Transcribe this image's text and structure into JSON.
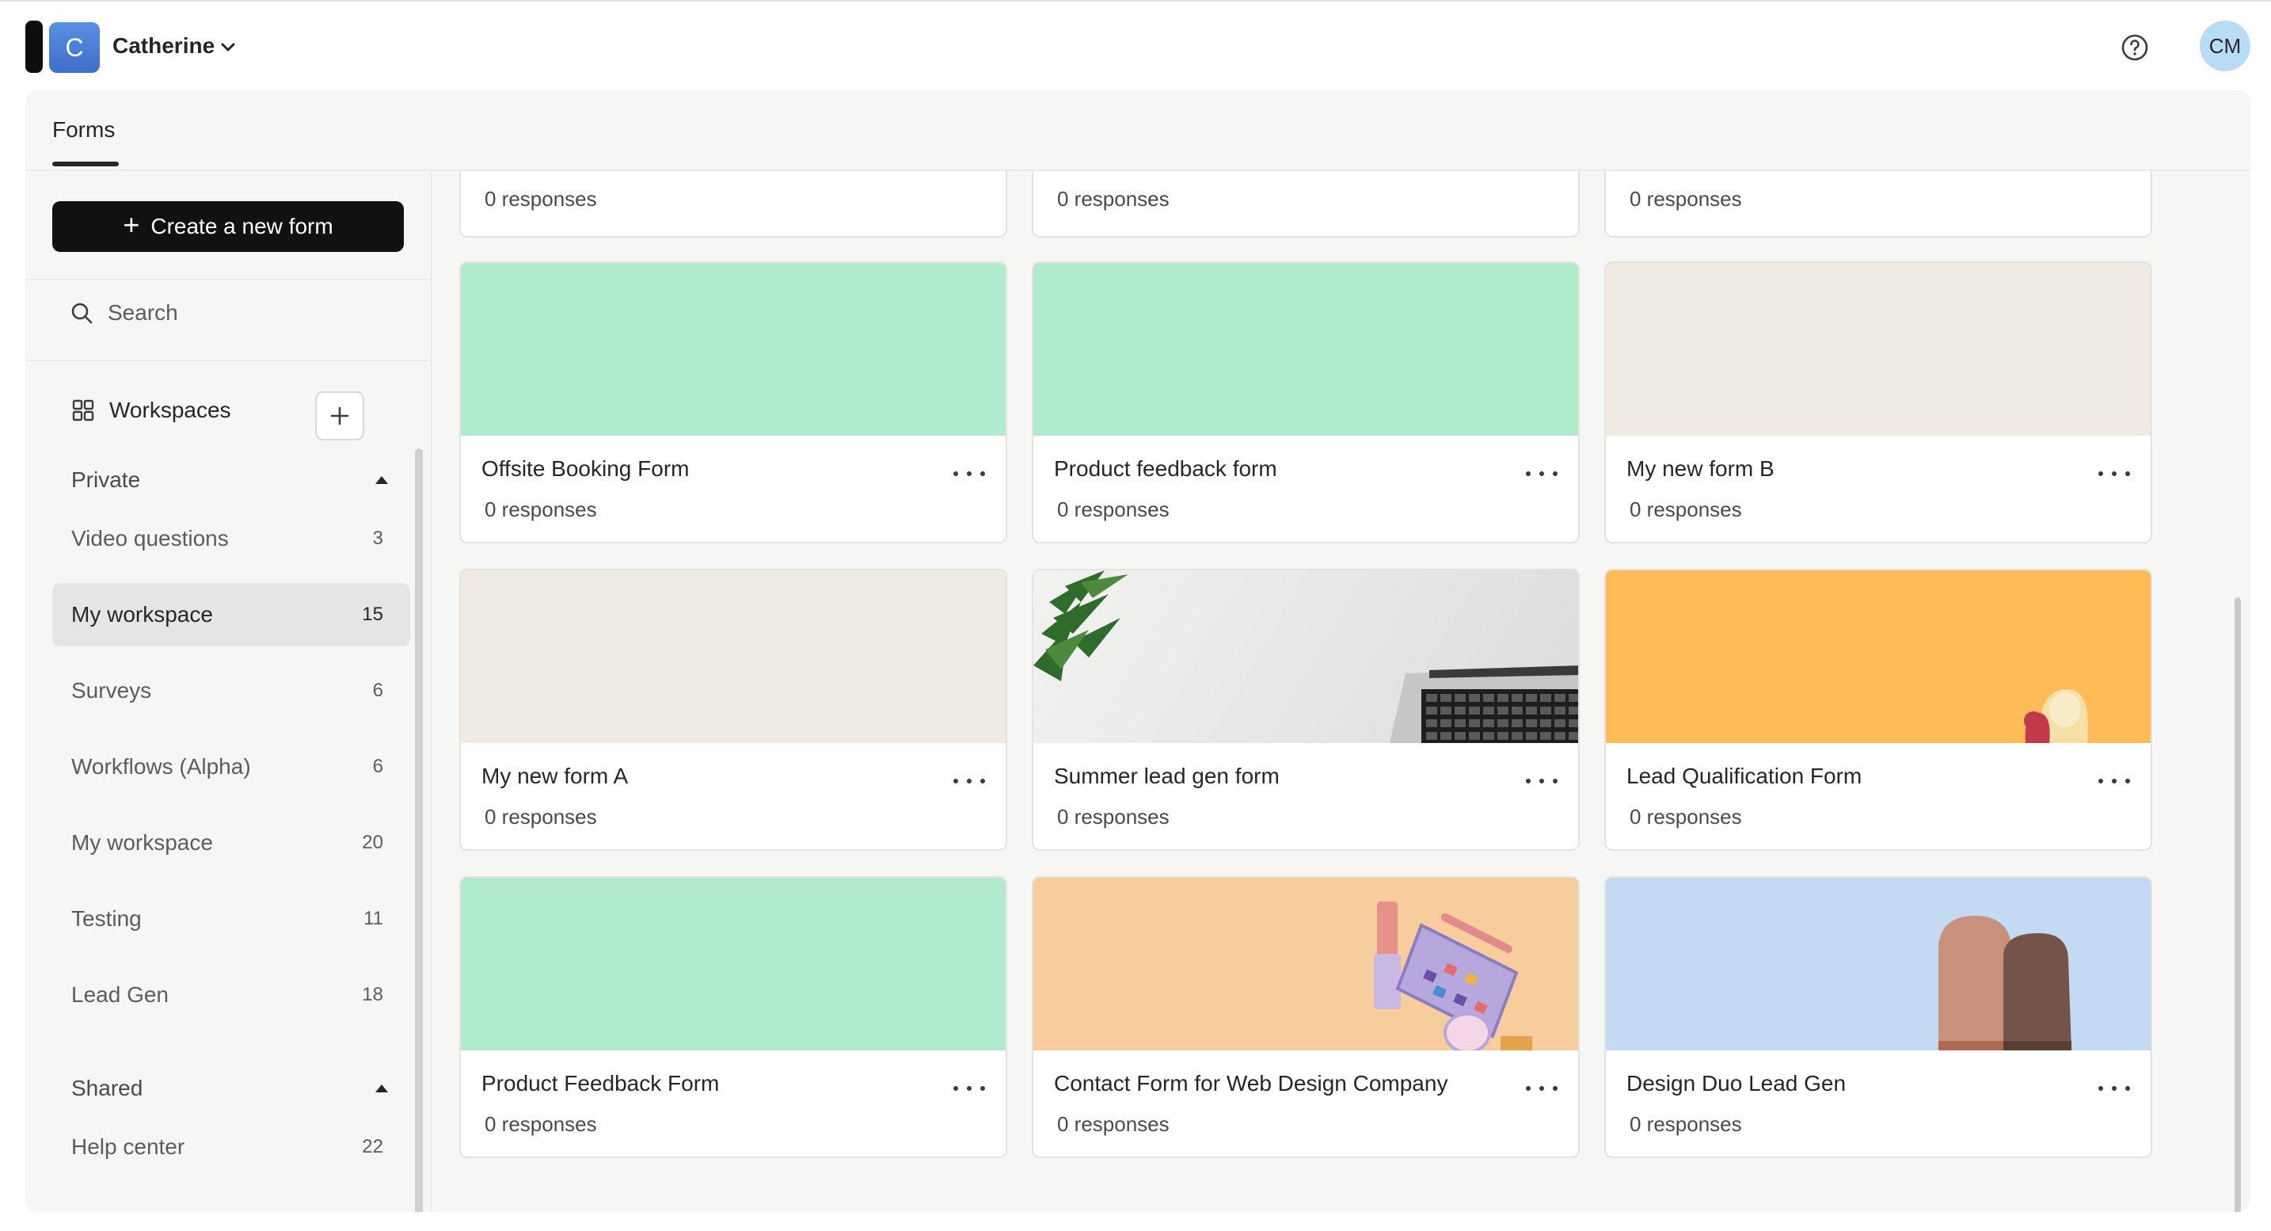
{
  "header": {
    "account_initial": "C",
    "account_name": "Catherine",
    "user_initials": "CM",
    "icons": [
      "chevron-down-icon",
      "help-icon"
    ]
  },
  "tabs": [
    {
      "label": "Forms",
      "active": true
    }
  ],
  "sidebar": {
    "create_label": "Create a new form",
    "search_placeholder": "Search",
    "workspaces_label": "Workspaces",
    "private_label": "Private",
    "shared_label": "Shared",
    "items": [
      {
        "label": "Video questions",
        "count": "3"
      },
      {
        "label": "My workspace",
        "count": "15",
        "active": true
      },
      {
        "label": "Surveys",
        "count": "6"
      },
      {
        "label": "Workflows (Alpha)",
        "count": "6"
      },
      {
        "label": "My workspace",
        "count": "20"
      },
      {
        "label": "Testing",
        "count": "11"
      },
      {
        "label": "Lead Gen",
        "count": "18"
      }
    ],
    "shared_items": [
      {
        "label": "Help center",
        "count": "22"
      }
    ]
  },
  "forms_partial": [
    {
      "responses": "0 responses"
    },
    {
      "responses": "0 responses"
    },
    {
      "responses": "0 responses"
    }
  ],
  "forms": [
    {
      "title": "Offsite Booking Form",
      "responses": "0 responses",
      "cover": "mint"
    },
    {
      "title": "Product feedback form",
      "responses": "0 responses",
      "cover": "mint"
    },
    {
      "title": "My new form B",
      "responses": "0 responses",
      "cover": "beige"
    },
    {
      "title": "My new form A",
      "responses": "0 responses",
      "cover": "beige"
    },
    {
      "title": "Summer lead gen form",
      "responses": "0 responses",
      "cover": "laptop-desk"
    },
    {
      "title": "Lead Qualification Form",
      "responses": "0 responses",
      "cover": "orange-people"
    },
    {
      "title": "Product Feedback Form",
      "responses": "0 responses",
      "cover": "mint"
    },
    {
      "title": "Contact Form for Web Design Company",
      "responses": "0 responses",
      "cover": "makeup-palette"
    },
    {
      "title": "Design Duo Lead Gen",
      "responses": "0 responses",
      "cover": "blue-duo"
    }
  ],
  "colors": {
    "mint": "#b0ebcb",
    "beige": "#f0ebe2",
    "orange": "#ffbb58",
    "peach": "#f8cd9e",
    "blue": "#c3daf2",
    "dark": "#111111"
  }
}
